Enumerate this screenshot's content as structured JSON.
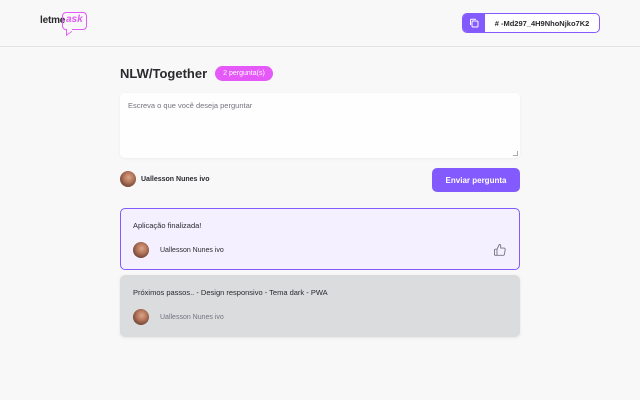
{
  "header": {
    "logo": {
      "prefix": "letme",
      "suffix": "ask"
    },
    "room_code": {
      "text": "# -Md297_4H9NhoNjko7K2",
      "icon": "copy-icon"
    }
  },
  "room": {
    "title": "NLW/Together",
    "question_count_badge": "2 pergunta(s)"
  },
  "form": {
    "placeholder": "Escreva o que você deseja perguntar",
    "user_name": "Uallesson Nunes ivo",
    "submit_label": "Enviar pergunta"
  },
  "questions": [
    {
      "content": "Aplicação finalizada!",
      "author": "Uallesson Nunes ivo",
      "highlighted": true,
      "answered": false,
      "like_icon": "thumbs-up-icon"
    },
    {
      "content": "Próximos passos.. - Design responsivo - Tema dark - PWA",
      "author": "Uallesson Nunes ivo",
      "highlighted": false,
      "answered": true
    }
  ],
  "colors": {
    "primary": "#835afd",
    "accent": "#e559f9",
    "highlight_bg": "#f4f0ff",
    "answered_bg": "#dbdcdd"
  }
}
